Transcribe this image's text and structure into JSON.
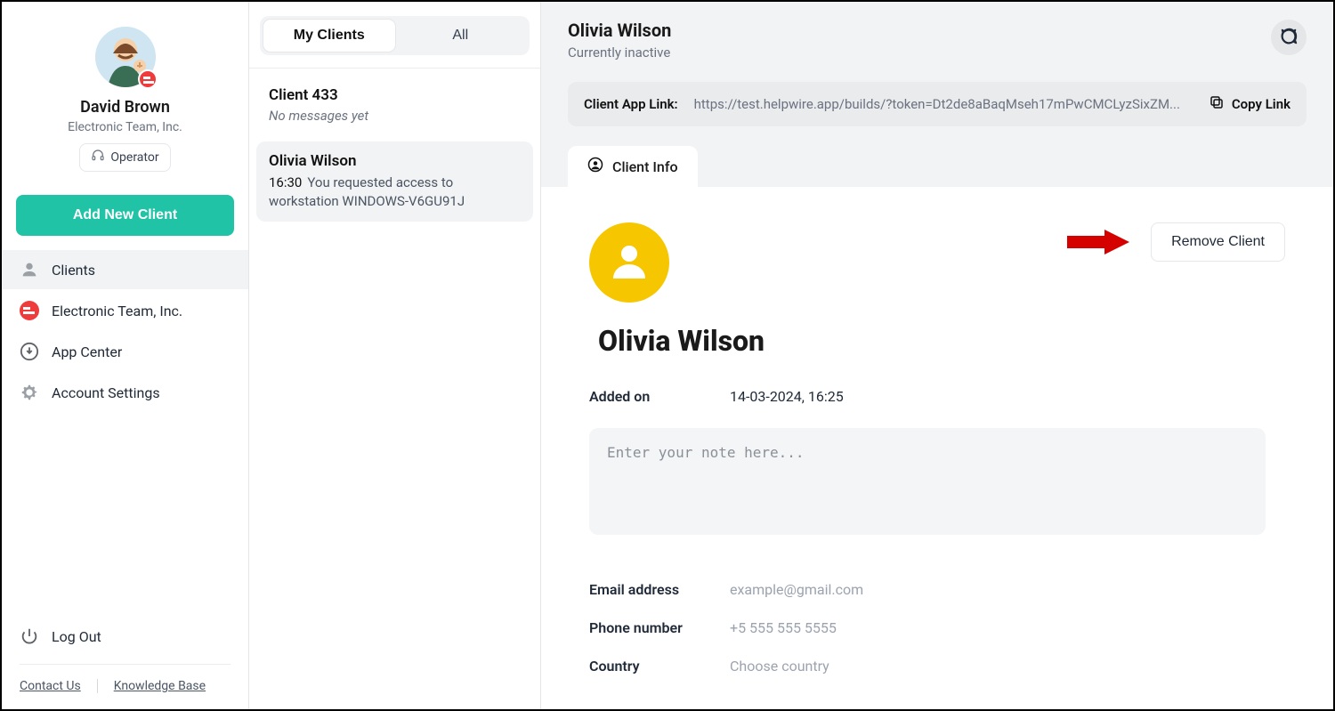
{
  "profile": {
    "name": "David Brown",
    "company": "Electronic Team, Inc.",
    "role": "Operator"
  },
  "buttons": {
    "add_client": "Add New Client",
    "remove_client": "Remove Client",
    "copy_link": "Copy Link"
  },
  "nav": {
    "clients": "Clients",
    "company": "Electronic Team, Inc.",
    "app_center": "App Center",
    "account_settings": "Account Settings",
    "logout": "Log Out"
  },
  "footer": {
    "contact": "Contact Us",
    "kb": "Knowledge Base"
  },
  "tabs": {
    "my_clients": "My Clients",
    "all": "All"
  },
  "client_list": [
    {
      "title": "Client 433",
      "sub": "No messages yet",
      "selected": false
    },
    {
      "title": "Olivia Wilson",
      "time": "16:30",
      "msg": "You requested access to workstation WINDOWS-V6GU91J",
      "selected": true
    }
  ],
  "main": {
    "name": "Olivia Wilson",
    "status": "Currently inactive",
    "link_label": "Client App Link:",
    "link_url": "https://test.helpwire.app/builds/?token=Dt2de8aBaqMseh17mPwCMCLyzSixZM...",
    "tab": "Client Info",
    "client_name": "Olivia Wilson",
    "added_label": "Added on",
    "added_value": "14-03-2024, 16:25",
    "note_placeholder": "Enter your note here...",
    "fields": {
      "email_label": "Email address",
      "email_placeholder": "example@gmail.com",
      "phone_label": "Phone number",
      "phone_placeholder": "+5 555 555 5555",
      "country_label": "Country",
      "country_placeholder": "Choose country"
    }
  }
}
